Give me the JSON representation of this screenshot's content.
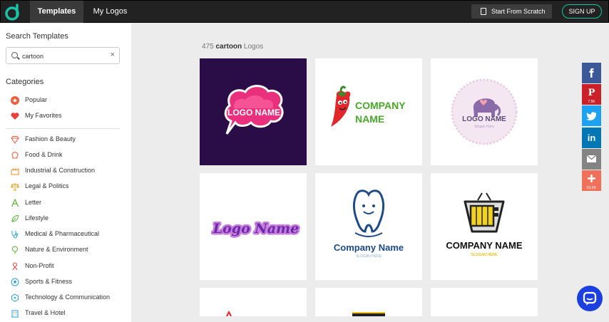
{
  "header": {
    "tabs": [
      {
        "label": "Templates",
        "active": true
      },
      {
        "label": "My Logos",
        "active": false
      }
    ],
    "start_scratch": "Start From Scratch",
    "signup": "SIGN UP"
  },
  "sidebar": {
    "search_title": "Search Templates",
    "search_value": "cartoon",
    "clear": "×",
    "categories_title": "Categories",
    "categories": [
      {
        "label": "Popular",
        "icon": "star-circle-icon"
      },
      {
        "label": "My Favorites",
        "icon": "heart-icon"
      },
      {
        "label": "Fashion & Beauty",
        "icon": "diamond-icon"
      },
      {
        "label": "Food & Drink",
        "icon": "chef-hat-icon"
      },
      {
        "label": "Industrial & Construction",
        "icon": "factory-icon"
      },
      {
        "label": "Legal & Politics",
        "icon": "scales-icon"
      },
      {
        "label": "Letter",
        "icon": "letter-a-icon"
      },
      {
        "label": "Lifestyle",
        "icon": "leaf-icon"
      },
      {
        "label": "Medical & Pharmaceutical",
        "icon": "stethoscope-icon"
      },
      {
        "label": "Nature & Environment",
        "icon": "tree-icon"
      },
      {
        "label": "Non-Profit",
        "icon": "ribbon-icon"
      },
      {
        "label": "Sports & Fitness",
        "icon": "soccer-ball-icon"
      },
      {
        "label": "Technology & Communication",
        "icon": "network-icon"
      },
      {
        "label": "Travel & Hotel",
        "icon": "hotel-icon"
      }
    ]
  },
  "results": {
    "count": "475",
    "query": "cartoon",
    "suffix": "Logos"
  },
  "logos": [
    {
      "line1": "LOGO NAME"
    },
    {
      "line1": "COMPANY",
      "line2": "NAME"
    },
    {
      "line1": "LOGO NAME",
      "line2": "Slogan Here"
    },
    {
      "line1": "Logo Name"
    },
    {
      "line1": "Company Name",
      "line2": "SLOGAN HERE"
    },
    {
      "line1": "COMPANY NAME",
      "line2": "SLOGAN HERE"
    }
  ],
  "share": [
    {
      "name": "facebook",
      "glyph": "f",
      "color": "#3b5998"
    },
    {
      "name": "pinterest",
      "glyph": "P",
      "color": "#cb2027",
      "count": "7.5K"
    },
    {
      "name": "twitter",
      "glyph": "t",
      "color": "#1da1f2"
    },
    {
      "name": "linkedin",
      "glyph": "in",
      "color": "#0077b5"
    },
    {
      "name": "email",
      "glyph": "✉",
      "color": "#848484"
    },
    {
      "name": "more",
      "glyph": "+",
      "color": "#f0705a",
      "count": "63.6K"
    }
  ],
  "colors": {
    "accent": "#19c3a7",
    "chat": "#1c3fe0"
  }
}
